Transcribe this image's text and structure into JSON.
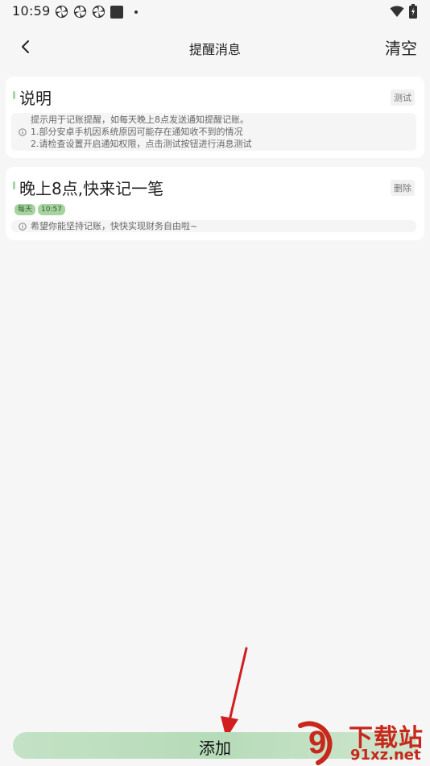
{
  "status_bar": {
    "time": "10:59",
    "icons": [
      "pinwheel-icon",
      "pinwheel-icon",
      "pinwheel-icon",
      "square-icon",
      "dot-icon",
      "wifi-icon",
      "battery-icon"
    ]
  },
  "header": {
    "title": "提醒消息",
    "clear_label": "清空",
    "back_icon": "chevron-left-icon"
  },
  "cards": [
    {
      "title": "说明",
      "action_label": "测试",
      "lines": [
        "提示用于记账提醒，如每天晚上8点发送通知提醒记账。",
        "1.部分安卓手机因系统原因可能存在通知收不到的情况",
        "2.请检查设置开启通知权限，点击测试按钮进行消息测试"
      ]
    },
    {
      "title": "晚上8点,快来记一笔",
      "action_label": "删除",
      "badges": [
        "每天",
        "10:57"
      ],
      "lines": [
        "希望你能坚持记账，快快实现财务自由啦~"
      ]
    }
  ],
  "add_button": {
    "label": "添加"
  },
  "watermark": {
    "main": "下载站",
    "sub": "91xz.net",
    "logo_text": "9"
  },
  "colors": {
    "accent_green": "#b6dbb8",
    "badge_green": "#a7d3a0",
    "watermark_red": "#c8281c",
    "arrow_red": "#d21e1e"
  }
}
